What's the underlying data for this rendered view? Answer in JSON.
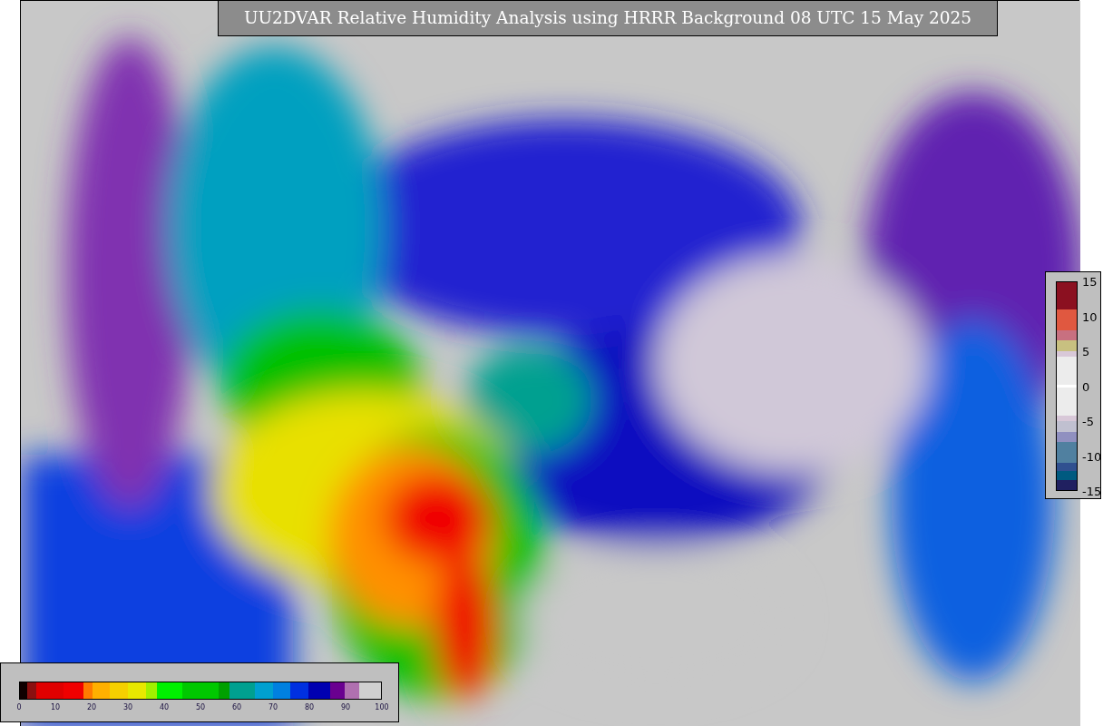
{
  "title": "UU2DVAR Relative Humidity Analysis using HRRR Background 08 UTC 15 May 2025",
  "humidity_colorbar": {
    "tick_labels": [
      "0",
      "10",
      "20",
      "30",
      "40",
      "50",
      "60",
      "70",
      "80",
      "90",
      "100"
    ]
  },
  "difference_colorbar": {
    "tick_labels": [
      "15",
      "10",
      "5",
      "0",
      "-5",
      "-10",
      "-15"
    ]
  }
}
